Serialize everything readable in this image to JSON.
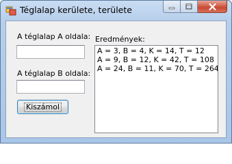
{
  "window": {
    "title": "Téglalap kerülete, területe",
    "icon": "app-window-icon"
  },
  "form": {
    "side_a_label": "A téglalap A oldala:",
    "side_a_value": "",
    "side_b_label": "A téglalap B oldala:",
    "side_b_value": "",
    "calculate_button": "Kiszámol",
    "results_label": "Eredmények:",
    "results": [
      "A = 3, B = 4, K = 14, T = 12",
      "A = 9, B = 12, K = 42, T = 108",
      "A = 24, B = 11, K = 70, T = 264"
    ]
  },
  "colors": {
    "title_bar": "#b7cfec",
    "close_button": "#c84a32",
    "client_background": "#f0f0f0"
  }
}
